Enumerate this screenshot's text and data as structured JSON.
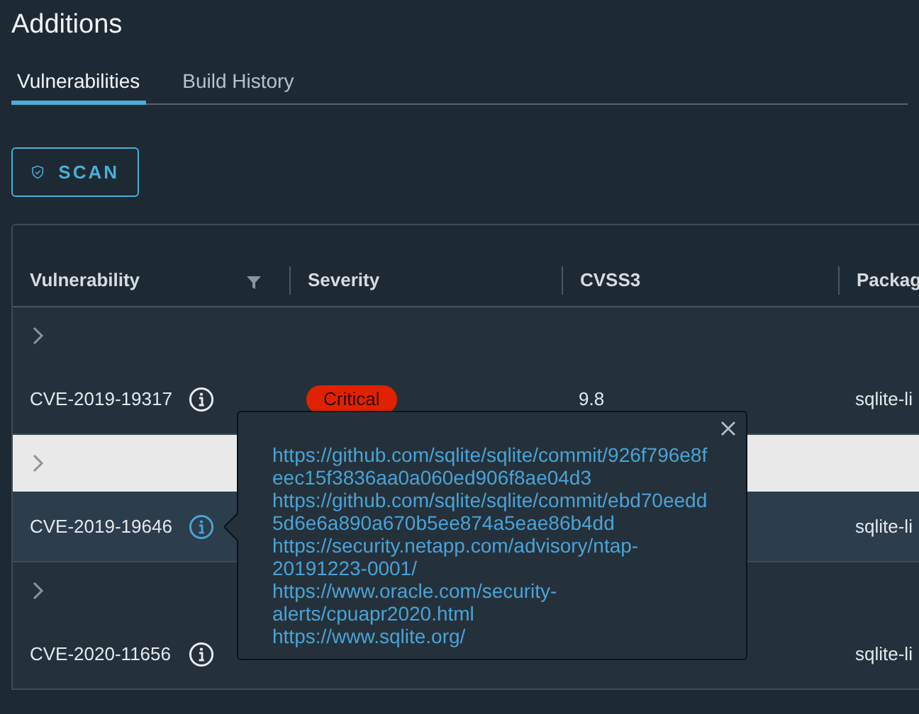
{
  "title": "Additions",
  "tabs": [
    {
      "label": "Vulnerabilities",
      "selected": true
    },
    {
      "label": "Build History",
      "selected": false
    }
  ],
  "scan_button": {
    "label": "SCAN"
  },
  "table": {
    "columns": [
      {
        "label": "Vulnerability",
        "filter": true
      },
      {
        "label": "Severity"
      },
      {
        "label": "CVSS3"
      },
      {
        "label": "Packag"
      }
    ],
    "rows": [
      {
        "vulnerability": "CVE-2019-19317",
        "severity": "Critical",
        "cvss3": "9.8",
        "package": "sqlite-li",
        "selected": false
      },
      {
        "vulnerability": "CVE-2019-19646",
        "package": "sqlite-li",
        "selected": true
      },
      {
        "vulnerability": "CVE-2020-11656",
        "package": "sqlite-li",
        "selected": false
      }
    ]
  },
  "popover": {
    "links": [
      "https://github.com/sqlite/sqlite/commit/926f796e8feec15f3836aa0a060ed906f8ae04d3",
      "https://github.com/sqlite/sqlite/commit/ebd70eedd5d6e6a890a670b5ee874a5eae86b4dd",
      "https://security.netapp.com/advisory/ntap-20191223-0001/",
      "https://www.oracle.com/security-alerts/cpuapr2020.html",
      "https://www.sqlite.org/"
    ]
  }
}
